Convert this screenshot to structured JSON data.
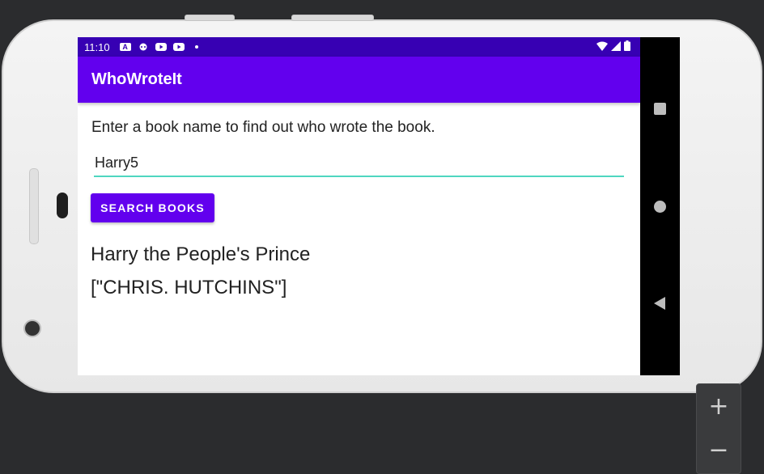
{
  "statusbar": {
    "time": "11:10",
    "icons": [
      "text-a-icon",
      "assistant-icon",
      "youtube-icon",
      "youtube-icon",
      "dot-icon"
    ],
    "right_icons": [
      "wifi-icon",
      "signal-icon",
      "battery-icon"
    ]
  },
  "app": {
    "title": "WhoWroteIt",
    "instructions": "Enter a book name to find out who wrote the book.",
    "search_input_value": "Harry5",
    "search_button_label": "SEARCH BOOKS",
    "result_title": "Harry the People's Prince",
    "result_author": "[\"CHRIS. HUTCHINS\"]"
  },
  "colors": {
    "primary": "#6200ee",
    "primary_dark": "#3700b3",
    "accent": "#4fd6c0"
  },
  "emulator": {
    "zoom_in": "+",
    "zoom_out": "−"
  }
}
